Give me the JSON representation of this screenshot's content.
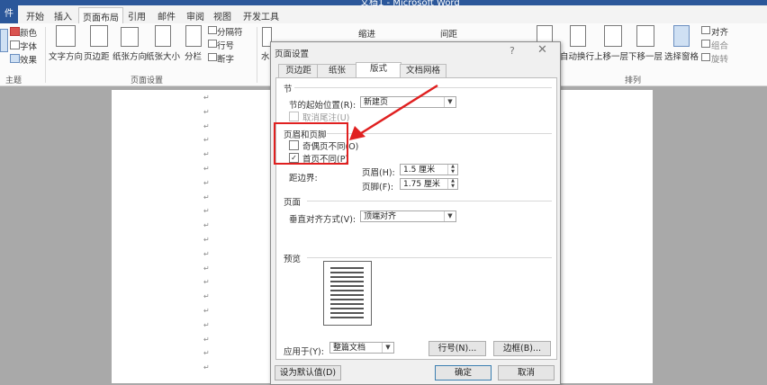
{
  "window": {
    "title": "文档1 - Microsoft Word"
  },
  "tabs": {
    "file": "件",
    "start": "开始",
    "insert": "插入",
    "layout": "页面布局",
    "references": "引用",
    "mailings": "邮件",
    "review": "审阅",
    "view": "视图",
    "developer": "开发工具"
  },
  "ribbon": {
    "color": "颜色",
    "font": "字体",
    "effects": "效果",
    "theme_group": "主题",
    "text_direction": "文字方向",
    "margins": "页边距",
    "orientation": "纸张方向",
    "size": "纸张大小",
    "columns": "分栏",
    "breaks": "分隔符",
    "line_numbers": "行号",
    "hyphenation": "断字",
    "page_setup_group": "页面设置",
    "watermark": "水",
    "indent": "缩进",
    "spacing": "间距",
    "wrap": "自动换行",
    "bring_forward": "上移一层",
    "send_backward": "下移一层",
    "selection_pane": "选择窗格",
    "align": "对齐",
    "group": "组合",
    "rotate": "旋转",
    "arrange_group": "排列"
  },
  "document": {
    "para_mark": "↵"
  },
  "dialog": {
    "title": "页面设置",
    "help": "?",
    "close": "✕",
    "tabs": [
      "页边距",
      "纸张",
      "版式",
      "文档网格"
    ],
    "section": {
      "heading": "节",
      "start_label": "节的起始位置(R):",
      "start_value": "新建页",
      "suppress_endnotes": "取消尾注(U)"
    },
    "header_footer": {
      "heading": "页眉和页脚",
      "odd_even": "奇偶页不同(O)",
      "odd_even_checked": false,
      "first_page": "首页不同(P)",
      "first_page_checked": true,
      "from_edge_label": "距边界:",
      "header_label": "页眉(H):",
      "header_value": "1.5 厘米",
      "footer_label": "页脚(F):",
      "footer_value": "1.75 厘米"
    },
    "page": {
      "heading": "页面",
      "valign_label": "垂直对齐方式(V):",
      "valign_value": "顶端对齐"
    },
    "preview": {
      "heading": "预览"
    },
    "apply_to_label": "应用于(Y):",
    "apply_to_value": "整篇文档",
    "line_numbers_btn": "行号(N)...",
    "borders_btn": "边框(B)...",
    "default_btn": "设为默认值(D)",
    "ok_btn": "确定",
    "cancel_btn": "取消"
  },
  "check_mark": "✓",
  "colors": {
    "highlight": "#e02020",
    "ribbon_blue": "#2b579a"
  }
}
